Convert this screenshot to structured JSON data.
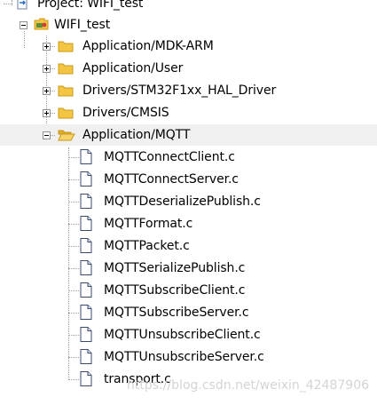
{
  "project": {
    "title": "Project: WIFI_test",
    "target": "WIFI_test"
  },
  "groups": [
    {
      "label": "Application/MDK-ARM",
      "expanded": false
    },
    {
      "label": "Application/User",
      "expanded": false
    },
    {
      "label": "Drivers/STM32F1xx_HAL_Driver",
      "expanded": false
    },
    {
      "label": "Drivers/CMSIS",
      "expanded": false
    },
    {
      "label": "Application/MQTT",
      "expanded": true,
      "selected": true
    }
  ],
  "files": [
    "MQTTConnectClient.c",
    "MQTTConnectServer.c",
    "MQTTDeserializePublish.c",
    "MQTTFormat.c",
    "MQTTPacket.c",
    "MQTTSerializePublish.c",
    "MQTTSubscribeClient.c",
    "MQTTSubscribeServer.c",
    "MQTTUnsubscribeClient.c",
    "MQTTUnsubscribeServer.c",
    "transport.c"
  ],
  "watermark": "https://blog.csdn.net/weixin_42487906",
  "icons": {
    "project": "project-icon",
    "target": "target-icon",
    "folder": "folder-icon",
    "open_folder": "open-folder-icon",
    "file": "c-file-icon",
    "expand": "expand-icon",
    "collapse": "collapse-icon"
  },
  "colors": {
    "folder": "#f4c542",
    "folder_dark": "#c99a1a",
    "selection": "#f0f0f0",
    "tree_line": "#a0a0a0"
  }
}
